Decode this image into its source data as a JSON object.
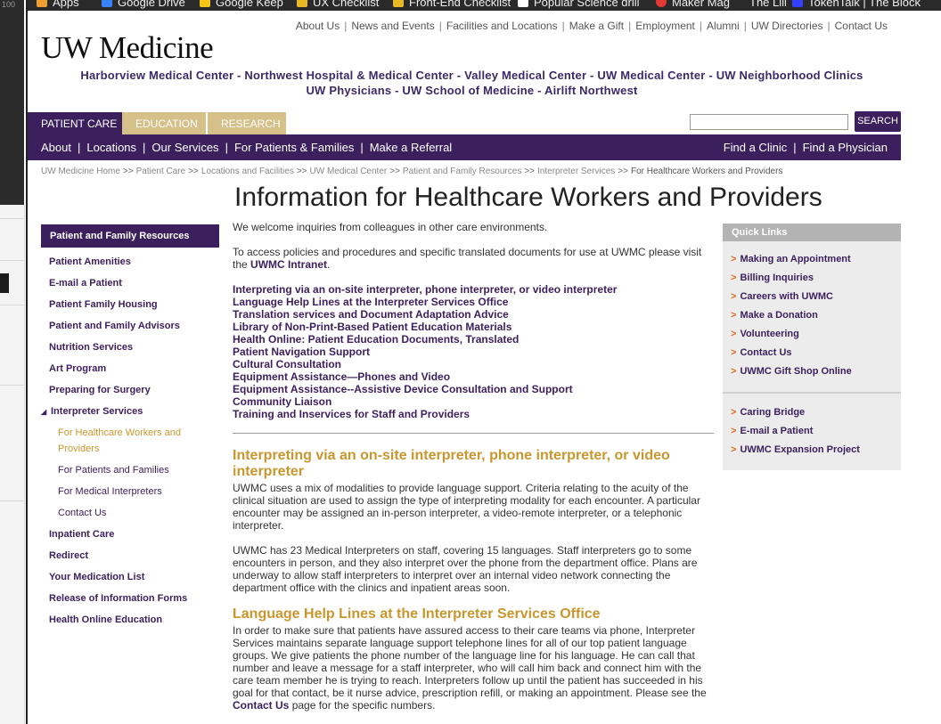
{
  "browser": {
    "left_number": "100",
    "bookmarks": [
      {
        "label": "Apps",
        "color": "#f0a030"
      },
      {
        "label": "Google Drive",
        "color": "#3b82f6"
      },
      {
        "label": "Google Keep",
        "color": "#f5c518"
      },
      {
        "label": "UX Checklist",
        "color": "#e8b923"
      },
      {
        "label": "Front-End Checklist",
        "color": "#e8b923"
      },
      {
        "label": "Popular Science drill",
        "color": "#ffffff"
      },
      {
        "label": "Maker Mag",
        "color": "#e53935"
      },
      {
        "label": "The Lili",
        "color": "#aaaaaa"
      },
      {
        "label": "TokenTalk | The Block",
        "color": "#3340ff"
      }
    ]
  },
  "header": {
    "logo": "UW Medicine",
    "utility_links": [
      "About Us",
      "News and Events",
      "Facilities and Locations",
      "Make a Gift",
      "Employment",
      "Alumni",
      "UW Directories",
      "Contact Us"
    ],
    "entities_line1": "Harborview Medical Center - Northwest Hospital & Medical Center - Valley Medical Center - UW Medical Center - UW Neighborhood Clinics",
    "entities_line2": "UW Physicians - UW School of Medicine - Airlift Northwest",
    "tabs": [
      {
        "label": "PATIENT CARE",
        "active": true
      },
      {
        "label": "EDUCATION",
        "active": false
      },
      {
        "label": "RESEARCH",
        "active": false
      }
    ],
    "search_button": "SEARCH",
    "search_value": "",
    "nav_left": [
      "About",
      "Locations",
      "Our Services",
      "For Patients & Families",
      "Make a Referral"
    ],
    "nav_right": [
      "Find a Clinic",
      "Find a Physician"
    ]
  },
  "breadcrumb": [
    "UW Medicine Home",
    "Patient Care",
    "Locations and Facilities",
    "UW Medical Center",
    "Patient and Family Resources",
    "Interpreter Services",
    "For Healthcare Workers and Providers"
  ],
  "page_title": "Information for Healthcare Workers and Providers",
  "sidebar": {
    "heading": "Patient and Family Resources",
    "items_before": [
      "Patient Amenities",
      "E-mail a Patient",
      "Patient Family Housing",
      "Patient and Family Advisors",
      "Nutrition Services",
      "Art Program",
      "Preparing for Surgery"
    ],
    "open_item": "Interpreter Services",
    "sub_current": "For Healthcare Workers and Providers",
    "sub_items": [
      "For Patients and Families",
      "For Medical Interpreters",
      "Contact Us"
    ],
    "items_after": [
      "Inpatient Care",
      "Redirect",
      "Your Medication List",
      "Release of Information Forms",
      "Health Online Education"
    ]
  },
  "main": {
    "intro": "We welcome inquiries from colleagues in other care environments.",
    "policies_text": "To access policies and procedures and specific translated documents for use at UWMC please visit the",
    "policies_link": "UWMC Intranet",
    "topic_links": [
      "Interpreting via an on-site interpreter, phone interpreter, or video interpreter",
      "Language Help Lines at the Interpreter Services Office",
      "Translation services and Document Adaptation Advice",
      "Library of Non-Print-Based Patient Education Materials",
      "Health Online: Patient Education Documents, Translated",
      "Patient Navigation Support",
      "Cultural Consultation",
      "Equipment Assistance—Phones and Video",
      "Equipment Assistance--Assistive Device Consultation and Support",
      "Community Liaison",
      "Training and Inservices for Staff and Providers"
    ],
    "section1_heading": "Interpreting via an on-site interpreter, phone interpreter, or video interpreter",
    "section1_p1": "UWMC uses a mix of modalities to provide language support. Criteria relating to the acuity of the clinical situation are used to assign the type of interpreting modality for each encounter. A particular encounter may be assigned an in-person interpreter, a video-remote interpreter, or a telephonic interpreter.",
    "section1_p2": "UWMC has 23 Medical Interpreters on staff, covering 15 languages. Staff interpreters go to some encounters in person, and they also interpret over the phone from the department office. Plans are underway to allow staff interpreters to interpret over an internal video network connecting the department office with the clinics and inpatient areas soon.",
    "section2_heading": "Language Help Lines at the Interpreter Services Office",
    "section2_p1": "In order to make sure that patients have assured access to their care teams via phone, Interpreter Services maintains separate language support telephone lines for all of our top patient language groups. We give patients the phone number of the language line for his language. He can call that number and leave a message for a staff interpreter, who will call him back and connect him with the care team member he is trying to reach. Interpreters follow up until the patient has succeeded in his goal for that contact, be it nurse advice, prescription refill, or making an appointment. Please see the",
    "section2_link": "Contact Us",
    "section2_tail": "page for the specific numbers."
  },
  "quick_links": {
    "heading": "Quick Links",
    "group1": [
      "Making an Appointment",
      "Billing Inquiries",
      "Careers with UWMC",
      "Make a Donation",
      "Volunteering",
      "Contact Us",
      "UWMC Gift Shop Online"
    ],
    "group2": [
      "Caring Bridge",
      "E-mail a Patient",
      "UWMC Expansion Project"
    ]
  },
  "colors": {
    "purple": "#3c1f5d",
    "gold": "#c9962e",
    "tab_gold": "#d5c08a",
    "arrow": "#e36c1f"
  }
}
